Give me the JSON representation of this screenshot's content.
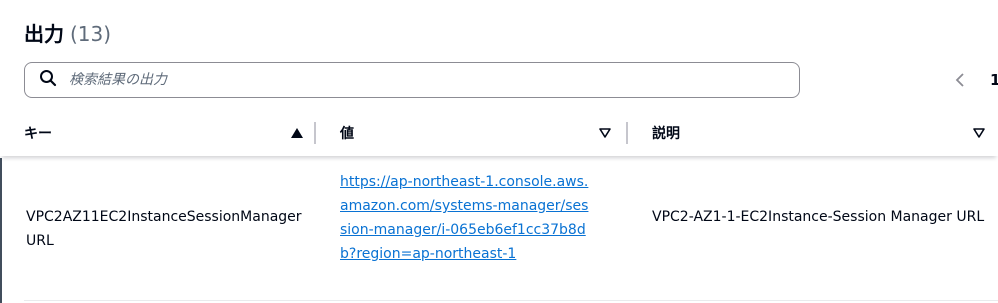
{
  "section": {
    "title": "出力",
    "count": "(13)"
  },
  "search": {
    "placeholder": "検索結果の出力",
    "value": "",
    "icon": "search-icon"
  },
  "pagination": {
    "prev_icon": "chevron-left-icon",
    "current_page": "1"
  },
  "table": {
    "columns": [
      {
        "label": "キー",
        "sort": "ascending"
      },
      {
        "label": "値",
        "sort": "none"
      },
      {
        "label": "説明",
        "sort": "none"
      }
    ],
    "rows": [
      {
        "key": "VPC2AZ11EC2InstanceSessionManagerURL",
        "value": "https://ap-northeast-1.console.aws.amazon.com/systems-manager/session-manager/i-065eb6ef1cc37b8db?region=ap-northeast-1",
        "description": "VPC2-AZ1-1-EC2Instance-Session Manager URL"
      }
    ]
  },
  "colors": {
    "link": "#0972d3",
    "text": "#000716",
    "muted": "#5f6b7a",
    "border": "#8c8c94"
  }
}
